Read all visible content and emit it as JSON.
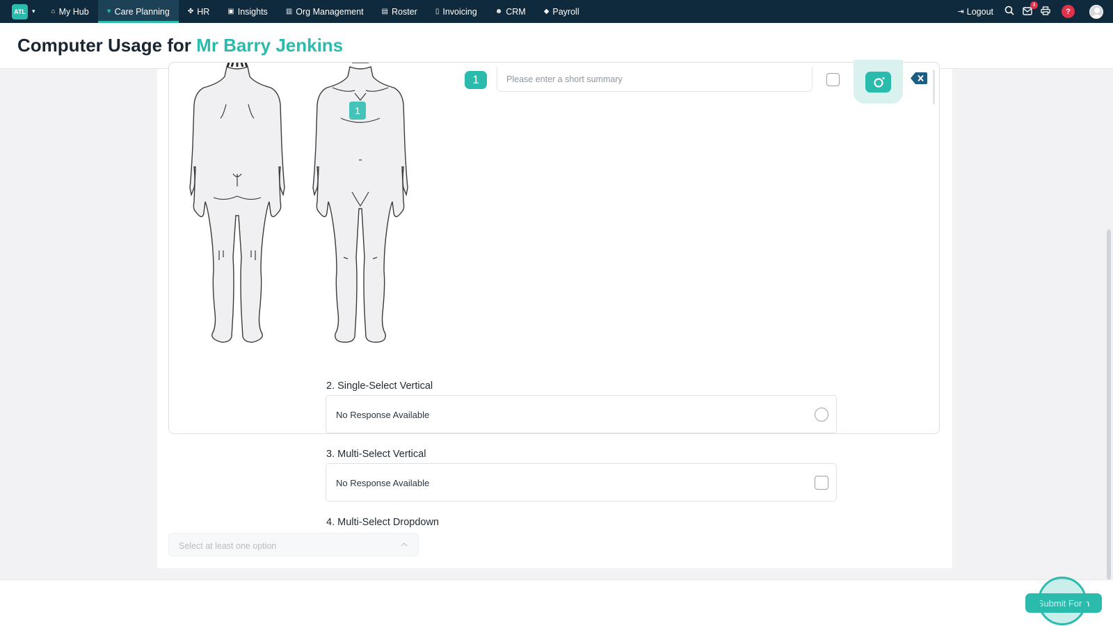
{
  "nav": {
    "brand": "ATL",
    "items": [
      {
        "label": "My Hub",
        "icon": "home-icon",
        "glyph": "⌂"
      },
      {
        "label": "Care Planning",
        "icon": "heart-icon",
        "glyph": "♥"
      },
      {
        "label": "HR",
        "icon": "paw-icon",
        "glyph": "✤"
      },
      {
        "label": "Insights",
        "icon": "chart-icon",
        "glyph": "▣"
      },
      {
        "label": "Org Management",
        "icon": "building-icon",
        "glyph": "▥"
      },
      {
        "label": "Roster",
        "icon": "calendar-icon",
        "glyph": "▤"
      },
      {
        "label": "Invoicing",
        "icon": "document-icon",
        "glyph": "▯"
      },
      {
        "label": "CRM",
        "icon": "users-icon",
        "glyph": "☻"
      },
      {
        "label": "Payroll",
        "icon": "tag-icon",
        "glyph": "◆"
      }
    ],
    "logout": "Logout",
    "mail_badge": "3",
    "help": "?"
  },
  "header": {
    "title_prefix": "Computer Usage for",
    "title_name": "Mr Barry Jenkins"
  },
  "bodymap": {
    "marker": "1",
    "entry_number": "1",
    "summary_placeholder": "Please enter a short summary",
    "summary_value": ""
  },
  "questions": [
    {
      "label": "2. Single-Select Vertical",
      "option": "No Response Available"
    },
    {
      "label": "3. Multi-Select Vertical",
      "option": "No Response Available"
    },
    {
      "label": "4. Multi-Select Dropdown",
      "placeholder": "Select at least one option"
    }
  ],
  "footer": {
    "submit": "Submit For n"
  },
  "colors": {
    "nav_bg": "#0f2a3c",
    "accent": "#2bbbad",
    "badge": "#e0334a",
    "delete": "#1c5d86"
  }
}
